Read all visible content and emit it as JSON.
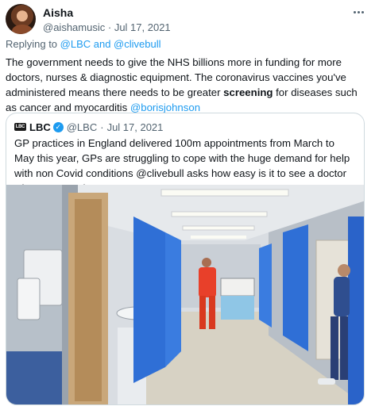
{
  "tweet": {
    "author_name": "Aisha",
    "author_handle": "@aishamusic",
    "separator": "·",
    "date": "Jul 17, 2021",
    "replying_prefix": "Replying to ",
    "replying_to": "@LBC and @clivebull",
    "text_before_bold": "The government needs to give the NHS billions more in funding for more doctors, nurses & diagnostic equipment. The coronavirus vaccines you've administered means there needs to be greater ",
    "text_bold": "screening",
    "text_after_bold": " for diseases such as cancer and myocarditis ",
    "mention": "@borisjohnson"
  },
  "quote": {
    "logo_text": "LBC",
    "author_name": "LBC",
    "verified_mark": "✓",
    "author_handle": "@LBC",
    "separator": "·",
    "date": "Jul 17, 2021",
    "text": "GP practices in England delivered 100m appointments from March to May this year, GPs are struggling to cope with the huge demand for help with non Covid conditions @clivebull asks how easy is it to see a doctor when you need to?"
  },
  "icons": {
    "more": "more-horizontal-icon",
    "verified": "verified-badge-icon"
  },
  "colors": {
    "link": "#1d9bf0",
    "secondary_text": "#536471",
    "border": "#cfd9de",
    "scrubs": "#e8402a",
    "curtain": "#2f6fd6"
  }
}
